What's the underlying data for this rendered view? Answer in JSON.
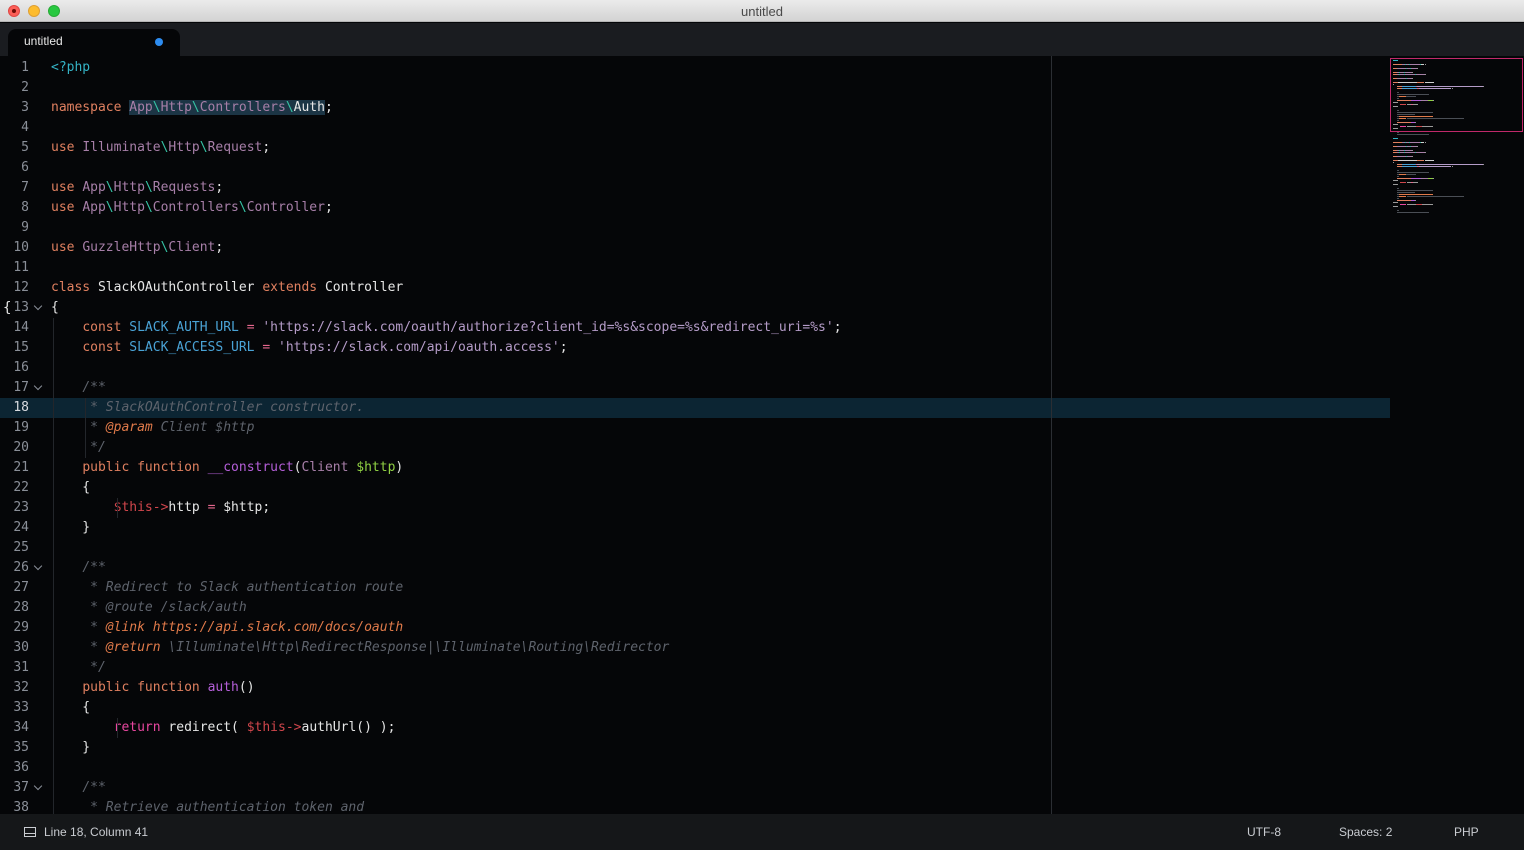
{
  "window": {
    "title": "untitled"
  },
  "tab": {
    "label": "untitled",
    "dirty": true
  },
  "editor": {
    "current_line": 18,
    "lines": [
      {
        "n": "1",
        "t": [
          [
            "tag",
            "<?php"
          ]
        ]
      },
      {
        "n": "2",
        "t": []
      },
      {
        "n": "3",
        "t": [
          [
            "kw",
            "namespace "
          ],
          [
            "ns hl",
            "App"
          ],
          [
            "sep hl",
            "\\"
          ],
          [
            "ns hl",
            "Http"
          ],
          [
            "sep hl",
            "\\"
          ],
          [
            "ns hl",
            "Controllers"
          ],
          [
            "sep hl",
            "\\"
          ],
          [
            "cls hl",
            "Auth"
          ],
          [
            "pl",
            ";"
          ]
        ]
      },
      {
        "n": "4",
        "t": []
      },
      {
        "n": "5",
        "t": [
          [
            "kw",
            "use "
          ],
          [
            "ns",
            "Illuminate"
          ],
          [
            "sep",
            "\\"
          ],
          [
            "ns",
            "Http"
          ],
          [
            "sep",
            "\\"
          ],
          [
            "ns",
            "Request"
          ],
          [
            "pl",
            ";"
          ]
        ]
      },
      {
        "n": "6",
        "t": []
      },
      {
        "n": "7",
        "t": [
          [
            "kw",
            "use "
          ],
          [
            "ns",
            "App"
          ],
          [
            "sep",
            "\\"
          ],
          [
            "ns",
            "Http"
          ],
          [
            "sep",
            "\\"
          ],
          [
            "ns",
            "Requests"
          ],
          [
            "pl",
            ";"
          ]
        ]
      },
      {
        "n": "8",
        "t": [
          [
            "kw",
            "use "
          ],
          [
            "ns",
            "App"
          ],
          [
            "sep",
            "\\"
          ],
          [
            "ns",
            "Http"
          ],
          [
            "sep",
            "\\"
          ],
          [
            "ns",
            "Controllers"
          ],
          [
            "sep",
            "\\"
          ],
          [
            "ns",
            "Controller"
          ],
          [
            "pl",
            ";"
          ]
        ]
      },
      {
        "n": "9",
        "t": []
      },
      {
        "n": "10",
        "t": [
          [
            "kw",
            "use "
          ],
          [
            "ns",
            "GuzzleHttp"
          ],
          [
            "sep",
            "\\"
          ],
          [
            "ns",
            "Client"
          ],
          [
            "pl",
            ";"
          ]
        ]
      },
      {
        "n": "11",
        "t": []
      },
      {
        "n": "12",
        "t": [
          [
            "kw",
            "class "
          ],
          [
            "cls",
            "SlackOAuthController "
          ],
          [
            "kw",
            "extends "
          ],
          [
            "cls",
            "Controller"
          ]
        ]
      },
      {
        "n": "13",
        "fold": true,
        "bracket": "{",
        "t": [
          [
            "pl",
            "{"
          ]
        ]
      },
      {
        "n": "14",
        "t": [
          [
            "pl",
            "    "
          ],
          [
            "kw",
            "const "
          ],
          [
            "const",
            "SLACK_AUTH_URL "
          ],
          [
            "op",
            "= "
          ],
          [
            "str",
            "'https://slack.com/oauth/authorize?client_id=%s&scope=%s&redirect_uri=%s'"
          ],
          [
            "pl",
            ";"
          ]
        ]
      },
      {
        "n": "15",
        "t": [
          [
            "pl",
            "    "
          ],
          [
            "kw",
            "const "
          ],
          [
            "const",
            "SLACK_ACCESS_URL "
          ],
          [
            "op",
            "= "
          ],
          [
            "str",
            "'https://slack.com/api/oauth.access'"
          ],
          [
            "pl",
            ";"
          ]
        ]
      },
      {
        "n": "16",
        "t": []
      },
      {
        "n": "17",
        "fold": true,
        "t": [
          [
            "pl",
            "    "
          ],
          [
            "cm",
            "/**"
          ]
        ]
      },
      {
        "n": "18",
        "t": [
          [
            "pl",
            "    "
          ],
          [
            "cm",
            " * SlackOAuthController constructor."
          ]
        ]
      },
      {
        "n": "19",
        "t": [
          [
            "pl",
            "    "
          ],
          [
            "cm",
            " * "
          ],
          [
            "cmtag",
            "@param "
          ],
          [
            "cm",
            "Client $http"
          ]
        ]
      },
      {
        "n": "20",
        "t": [
          [
            "pl",
            "    "
          ],
          [
            "cm",
            " */"
          ]
        ]
      },
      {
        "n": "21",
        "t": [
          [
            "pl",
            "    "
          ],
          [
            "kw",
            "public "
          ],
          [
            "kw",
            "function "
          ],
          [
            "fn",
            "__construct"
          ],
          [
            "pl",
            "("
          ],
          [
            "ns",
            "Client "
          ],
          [
            "var",
            "$http"
          ],
          [
            "pl",
            ")"
          ]
        ]
      },
      {
        "n": "22",
        "t": [
          [
            "pl",
            "    {"
          ]
        ]
      },
      {
        "n": "23",
        "t": [
          [
            "pl",
            "        "
          ],
          [
            "this",
            "$this->"
          ],
          [
            "pl",
            "http "
          ],
          [
            "op",
            "= "
          ],
          [
            "pl",
            "$http;"
          ]
        ]
      },
      {
        "n": "24",
        "t": [
          [
            "pl",
            "    }"
          ]
        ]
      },
      {
        "n": "25",
        "t": []
      },
      {
        "n": "26",
        "fold": true,
        "t": [
          [
            "pl",
            "    "
          ],
          [
            "cm",
            "/**"
          ]
        ]
      },
      {
        "n": "27",
        "t": [
          [
            "pl",
            "    "
          ],
          [
            "cm",
            " * Redirect to Slack authentication route"
          ]
        ]
      },
      {
        "n": "28",
        "t": [
          [
            "pl",
            "    "
          ],
          [
            "cm",
            " * @route /slack/auth"
          ]
        ]
      },
      {
        "n": "29",
        "t": [
          [
            "pl",
            "    "
          ],
          [
            "cm",
            " * "
          ],
          [
            "cmtag",
            "@link https://api.slack.com/docs/oauth"
          ]
        ]
      },
      {
        "n": "30",
        "t": [
          [
            "pl",
            "    "
          ],
          [
            "cm",
            " * "
          ],
          [
            "cmtag",
            "@return "
          ],
          [
            "cm",
            "\\Illuminate\\Http\\RedirectResponse|\\Illuminate\\Routing\\Redirector"
          ]
        ]
      },
      {
        "n": "31",
        "t": [
          [
            "pl",
            "    "
          ],
          [
            "cm",
            " */"
          ]
        ]
      },
      {
        "n": "32",
        "t": [
          [
            "pl",
            "    "
          ],
          [
            "kw",
            "public "
          ],
          [
            "kw",
            "function "
          ],
          [
            "fn",
            "auth"
          ],
          [
            "pl",
            "()"
          ]
        ]
      },
      {
        "n": "33",
        "t": [
          [
            "pl",
            "    {"
          ]
        ]
      },
      {
        "n": "34",
        "t": [
          [
            "pl",
            "        "
          ],
          [
            "ret",
            "return "
          ],
          [
            "pl",
            "redirect( "
          ],
          [
            "this",
            "$this->"
          ],
          [
            "pl",
            "authUrl() );"
          ]
        ]
      },
      {
        "n": "35",
        "t": [
          [
            "pl",
            "    }"
          ]
        ]
      },
      {
        "n": "36",
        "t": []
      },
      {
        "n": "37",
        "fold": true,
        "t": [
          [
            "pl",
            "    "
          ],
          [
            "cm",
            "/**"
          ]
        ]
      },
      {
        "n": "38",
        "t": [
          [
            "pl",
            "    "
          ],
          [
            "cm",
            " * Retrieve authentication token and"
          ]
        ]
      }
    ]
  },
  "colors": {
    "background": "#050608",
    "current_line": "#0c2533",
    "minimap_viewport": "#c0296a",
    "tab_dirty": "#2d8cf0"
  },
  "statusbar": {
    "icon": "panel-icon",
    "position": "Line 18, Column 41",
    "encoding": "UTF-8",
    "indentation": "Spaces: 2",
    "syntax": "PHP"
  }
}
